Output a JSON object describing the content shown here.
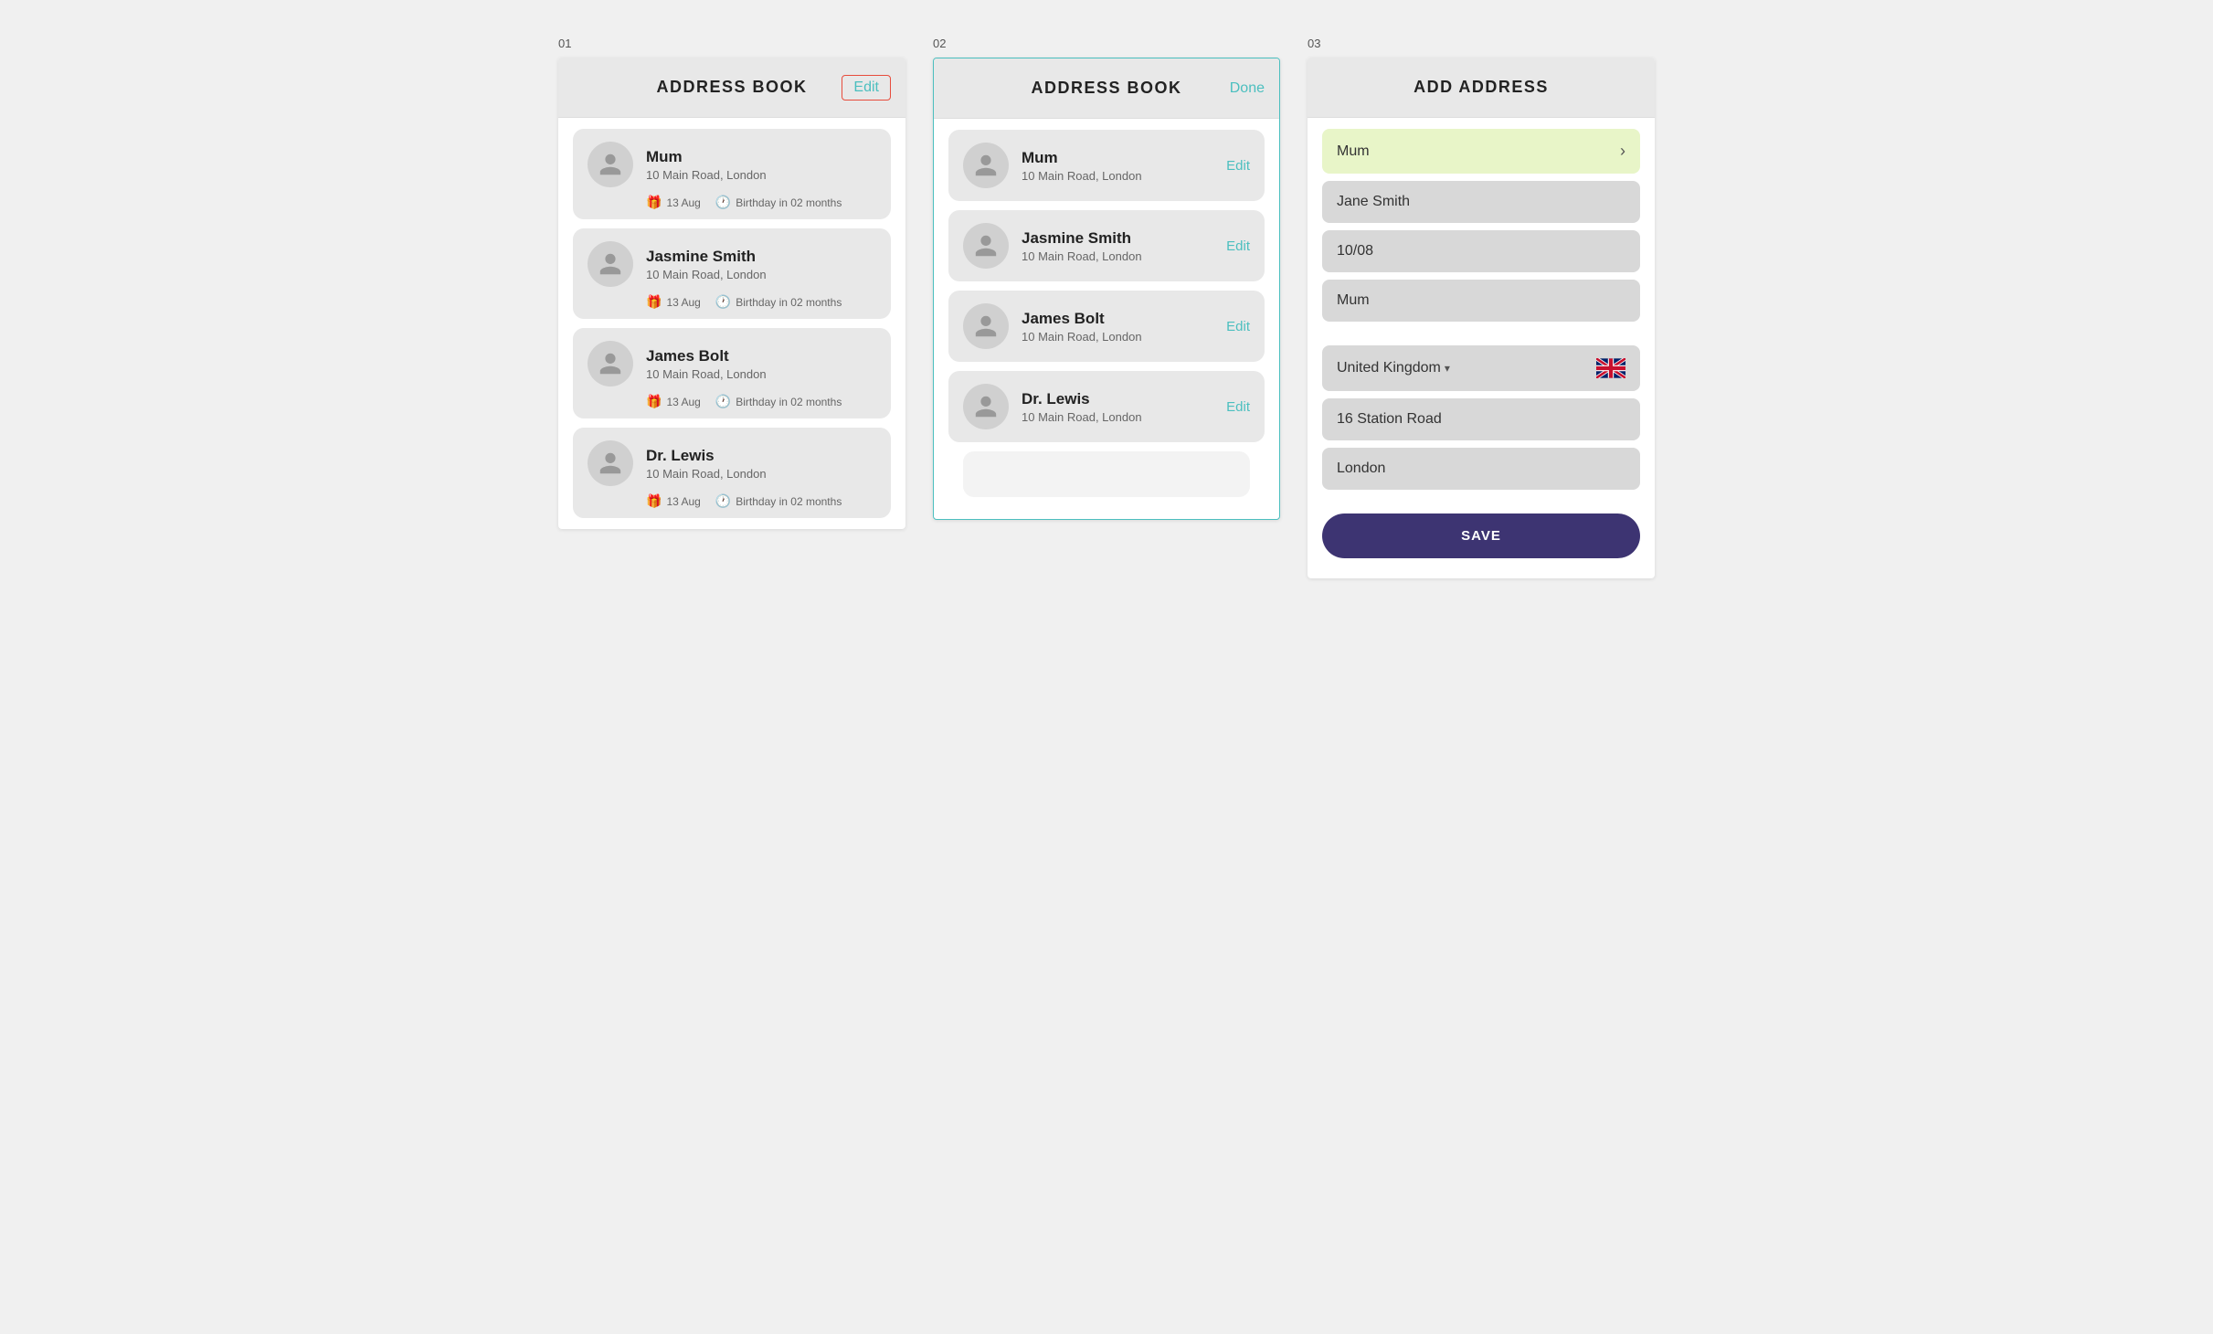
{
  "screen1": {
    "number": "01",
    "title": "ADDRESS BOOK",
    "editButton": "Edit",
    "contacts": [
      {
        "name": "Mum",
        "address": "10 Main Road, London",
        "birthday": "13 Aug",
        "birthdayLabel": "Birthday in 02 months"
      },
      {
        "name": "Jasmine Smith",
        "address": "10 Main Road, London",
        "birthday": "13 Aug",
        "birthdayLabel": "Birthday in 02 months"
      },
      {
        "name": "James Bolt",
        "address": "10 Main Road, London",
        "birthday": "13 Aug",
        "birthdayLabel": "Birthday in 02 months"
      },
      {
        "name": "Dr. Lewis",
        "address": "10 Main Road, London",
        "birthday": "13 Aug",
        "birthdayLabel": "Birthday in 02 months"
      }
    ]
  },
  "screen2": {
    "number": "02",
    "title": "ADDRESS BOOK",
    "doneButton": "Done",
    "contacts": [
      {
        "name": "Mum",
        "address": "10 Main Road, London",
        "editLabel": "Edit"
      },
      {
        "name": "Jasmine Smith",
        "address": "10 Main Road, London",
        "editLabel": "Edit"
      },
      {
        "name": "James Bolt",
        "address": "10 Main Road, London",
        "editLabel": "Edit"
      },
      {
        "name": "Dr. Lewis",
        "address": "10 Main Road, London",
        "editLabel": "Edit"
      }
    ]
  },
  "screen3": {
    "number": "03",
    "title": "ADD ADDRESS",
    "fields": {
      "nickname": "Mum",
      "recipientName": "Jane Smith",
      "birthday": "10/08",
      "relationship": "Mum",
      "country": "United Kingdom",
      "streetAddress": "16 Station Road",
      "city": "London"
    },
    "saveButton": "SAVE"
  }
}
